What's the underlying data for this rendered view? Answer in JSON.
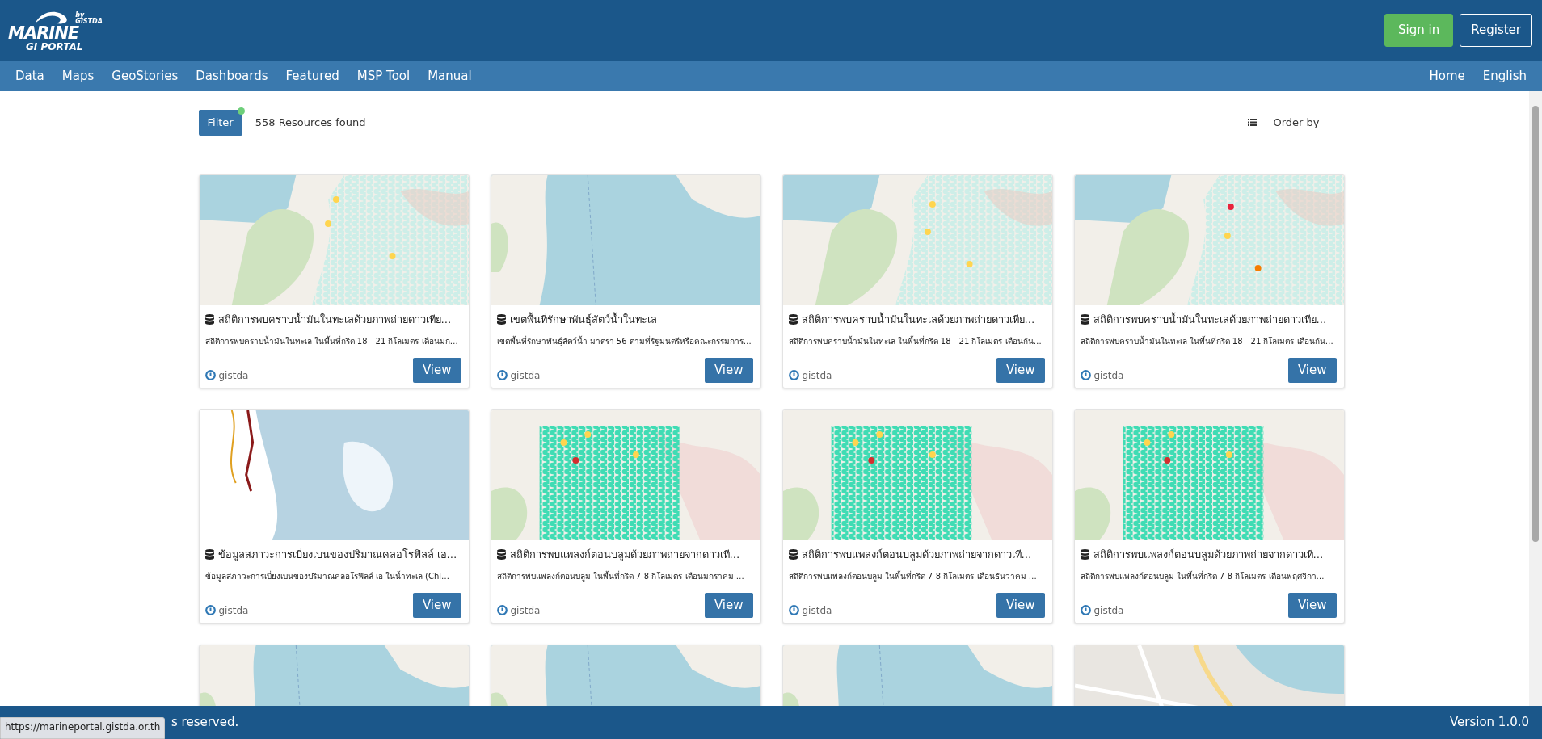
{
  "header": {
    "logo": {
      "by": "by GISTDA",
      "brand": "MARINE",
      "subtitle": "GI PORTAL"
    },
    "buttons": [
      {
        "label": "Sign in",
        "kind": "primary"
      },
      {
        "label": "Register",
        "kind": "outline"
      }
    ]
  },
  "nav": {
    "left": [
      "Data",
      "Maps",
      "GeoStories",
      "Dashboards",
      "Featured",
      "MSP Tool",
      "Manual"
    ],
    "right": [
      "Home",
      "English"
    ]
  },
  "toolbar": {
    "filter": {
      "label": "Filter",
      "active": true
    },
    "count": "558 Resources found",
    "order": "Order by"
  },
  "cards": [
    {
      "kind": "hex-map",
      "title": "สถิติการพบคราบน้ำมันในทะเลด้วยภาพถ่ายดาวเทีย…",
      "description": "สถิติการพบคราบน้ำมันในทะเล ในพื้นที่กริด 18 - 21 กิโลเมตร เดือนมก…",
      "owner": "gistda",
      "action": "View"
    },
    {
      "kind": "coast-map",
      "title": "เขตพื้นที่รักษาพันธุ์สัตว์น้ำในทะเล",
      "description": "เขตพื้นที่รักษาพันธุ์สัตว์น้ำ มาตรา 56 ตามที่รัฐมนตรีหรือคณะกรรมการ…",
      "owner": "gistda",
      "action": "View"
    },
    {
      "kind": "hex-map",
      "title": "สถิติการพบคราบน้ำมันในทะเลด้วยภาพถ่ายดาวเทีย…",
      "description": "สถิติการพบคราบน้ำมันในทะเล ในพื้นที่กริด 18 - 21 กิโลเมตร เดือนกัน…",
      "owner": "gistda",
      "action": "View"
    },
    {
      "kind": "hex-map",
      "title": "สถิติการพบคราบน้ำมันในทะเลด้วยภาพถ่ายดาวเทีย…",
      "description": "สถิติการพบคราบน้ำมันในทะเล ในพื้นที่กริด 18 - 21 กิโลเมตร เดือนกัน…",
      "owner": "gistda",
      "action": "View"
    },
    {
      "kind": "chlorophyll",
      "title": "ข้อมูลสภาวะการเบี่ยงเบนของปริมาณคลอโรฟิลล์ เอ…",
      "description": "ข้อมูลสภาวะการเบี่ยงเบนของปริมาณคลอโรฟิลล์ เอ ในน้ำทะเล (Chl…",
      "owner": "gistda",
      "action": "View"
    },
    {
      "kind": "hex-dense",
      "title": "สถิติการพบแพลงก์ตอนบลูมด้วยภาพถ่ายจากดาวเที…",
      "description": "สถิติการพบแพลงก์ตอนบลูม ในพื้นที่กริด 7-8 กิโลเมตร เดือนมกราคม …",
      "owner": "gistda",
      "action": "View"
    },
    {
      "kind": "hex-dense",
      "title": "สถิติการพบแพลงก์ตอนบลูมด้วยภาพถ่ายจากดาวเที…",
      "description": "สถิติการพบแพลงก์ตอนบลูม ในพื้นที่กริด 7-8 กิโลเมตร เดือนธันวาคม …",
      "owner": "gistda",
      "action": "View"
    },
    {
      "kind": "hex-dense",
      "title": "สถิติการพบแพลงก์ตอนบลูมด้วยภาพถ่ายจากดาวเที…",
      "description": "สถิติการพบแพลงก์ตอนบลูม ในพื้นที่กริด 7-8 กิโลเมตร เดือนพฤศจิกา…",
      "owner": "gistda",
      "action": "View"
    },
    {
      "kind": "coast-map"
    },
    {
      "kind": "coast-map"
    },
    {
      "kind": "coast-map"
    },
    {
      "kind": "street-map"
    }
  ],
  "footer": {
    "copyright": "s reserved.",
    "version": "Version 1.0.0"
  },
  "status_url": "https://marineportal.gistda.or.th"
}
